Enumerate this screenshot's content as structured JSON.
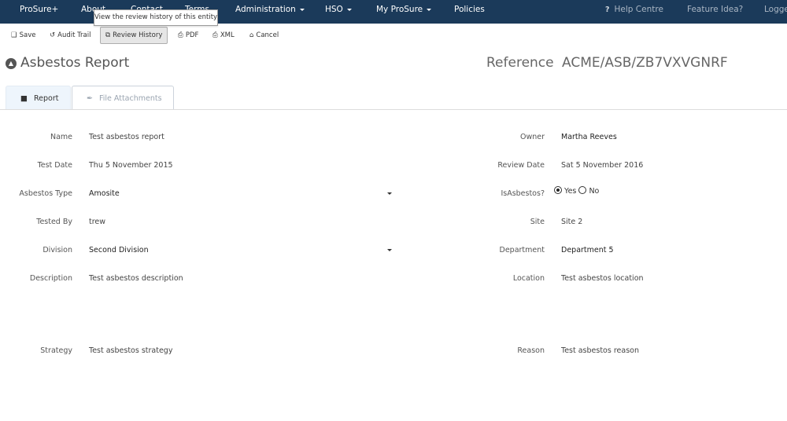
{
  "navbar": {
    "items": [
      {
        "label": "ProSure+"
      },
      {
        "label": "About"
      },
      {
        "label": "Contact"
      },
      {
        "label": "Terms"
      },
      {
        "label": "Administration",
        "dropdown": true
      },
      {
        "label": "HSO",
        "dropdown": true
      },
      {
        "label": "My ProSure",
        "dropdown": true
      },
      {
        "label": "Policies"
      }
    ],
    "right": {
      "help_icon": "?",
      "help_label": "Help Centre",
      "feature_label": "Feature Idea?",
      "logged_label": "Logge"
    },
    "color": "#1b3a5a"
  },
  "tooltip": {
    "text": "View the review history of this entity"
  },
  "toolbar": {
    "save": {
      "icon": "save-icon",
      "glyph": "❑",
      "label": "Save"
    },
    "audit": {
      "icon": "history-icon",
      "glyph": "↺",
      "label": "Audit Trail"
    },
    "review": {
      "icon": "copy-icon",
      "glyph": "⧉",
      "label": "Review History"
    },
    "pdf": {
      "icon": "pdf-file-icon",
      "glyph": "⎙",
      "label": "PDF"
    },
    "xml": {
      "icon": "xml-file-icon",
      "glyph": "⎙",
      "label": "XML"
    },
    "cancel": {
      "icon": "home-icon",
      "glyph": "⌂",
      "label": "Cancel"
    }
  },
  "page": {
    "title_icon": "▲",
    "title": "Asbestos Report",
    "reference_label": "Reference",
    "reference_value": "ACME/ASB/ZB7VXVGNRF"
  },
  "tabs": [
    {
      "label": "Report",
      "glyph": "■",
      "active": true
    },
    {
      "label": "File Attachments",
      "glyph": "✒",
      "active": false
    }
  ],
  "form": {
    "name": {
      "label": "Name",
      "value": "Test asbestos report"
    },
    "test_date": {
      "label": "Test Date",
      "value": "Thu 5 November 2015"
    },
    "asbestos_type": {
      "label": "Asbestos Type",
      "value": "Amosite"
    },
    "tested_by": {
      "label": "Tested By",
      "value": "trew"
    },
    "division": {
      "label": "Division",
      "value": "Second Division"
    },
    "description": {
      "label": "Description",
      "value": "Test asbestos description"
    },
    "strategy": {
      "label": "Strategy",
      "value": "Test asbestos strategy"
    },
    "owner": {
      "label": "Owner",
      "value": "Martha Reeves"
    },
    "review_date": {
      "label": "Review Date",
      "value": "Sat 5 November 2016"
    },
    "is_asbestos": {
      "label": "IsAsbestos?",
      "options": [
        "Yes",
        "No"
      ],
      "selected": "Yes"
    },
    "site": {
      "label": "Site",
      "value": "Site 2"
    },
    "department": {
      "label": "Department",
      "value": "Department 5"
    },
    "location": {
      "label": "Location",
      "value": "Test asbestos location"
    },
    "reason": {
      "label": "Reason",
      "value": "Test asbestos reason"
    }
  }
}
